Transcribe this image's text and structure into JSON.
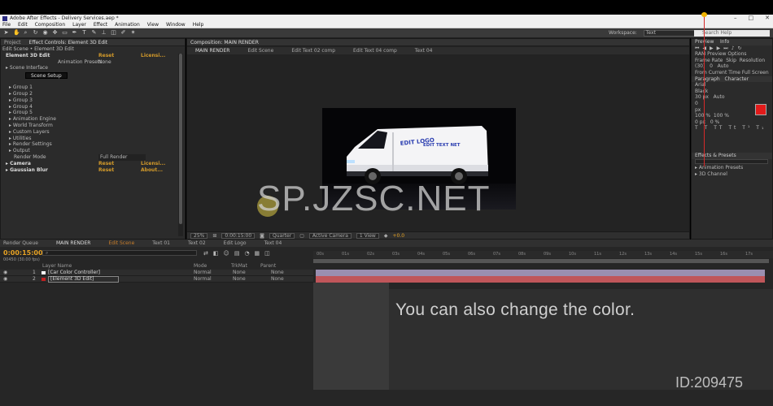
{
  "window": {
    "title": "Adobe After Effects - Delivery Services.aep *",
    "controls": [
      "–",
      "□",
      "✕"
    ]
  },
  "menu": [
    "File",
    "Edit",
    "Composition",
    "Layer",
    "Effect",
    "Animation",
    "View",
    "Window",
    "Help"
  ],
  "toolbar": {
    "workspace_label": "Workspace:",
    "workspace_value": "Text",
    "search_placeholder": "Search Help"
  },
  "effect_controls": {
    "tabs": [
      "Project",
      "Effect Controls: Element 3D Edit"
    ],
    "breadcrumb": "Edit Scene • Element 3D Edit",
    "rows": [
      {
        "label": "Element 3D Edit",
        "v": "Reset",
        "v2": "Licensi...",
        "bold": true
      },
      {
        "label": "Animation Presets:",
        "v": "None",
        "v2": "",
        "bold": false
      },
      {
        "label": "▸ Scene Interface",
        "v": "",
        "v2": "",
        "bold": false
      }
    ],
    "scene_button": "Scene Setup",
    "groups": [
      "▸ Group 1",
      "▸ Group 2",
      "▸ Group 3",
      "▸ Group 4",
      "▸ Group 5",
      "▸ Animation Engine",
      "▸ World Transform",
      "▸ Custom Layers",
      "▸ Utilities",
      "▸ Render Settings",
      "▸ Output"
    ],
    "render_mode_label": "Render Mode",
    "render_mode_value": "Full Render",
    "footer_rows": [
      {
        "label": "▸ Camera",
        "v": "Reset",
        "v2": "Licensi..."
      },
      {
        "label": "▸ Gaussian Blur",
        "v": "Reset",
        "v2": "About..."
      }
    ]
  },
  "composition": {
    "title": "Composition: MAIN RENDER",
    "subtabs": [
      "MAIN RENDER",
      "Edit Scene",
      "Edit Text 02 comp",
      "Edit Text 04 comp",
      "Text 04"
    ],
    "van_text_1": "EDIT LOGO",
    "van_text_2": "EDIT TEXT NET",
    "zoom": "25%",
    "timecode": "0:00:15:00",
    "resolution": "Quarter",
    "camera": "Active Camera",
    "views": "1 View",
    "exposure": "+0.0"
  },
  "right_panel": {
    "preview_tabs": [
      "Preview",
      "Info"
    ],
    "ram_label": "RAM Preview Options",
    "frame_rate_label": "Frame Rate",
    "skip_label": "Skip",
    "resolution_label": "Resolution",
    "frame_rate_value": "(30)",
    "skip_value": "0",
    "resolution_value": "Auto",
    "from_current": "From Current Time",
    "full_screen": "Full Screen",
    "para_tabs": [
      "Paragraph",
      "Character"
    ],
    "font": "Arial",
    "style": "Black",
    "size": "30 px",
    "leading": "Auto",
    "tracking": "0",
    "stroke": "px",
    "scale_v": "100 %",
    "scale_h": "100 %",
    "baseline": "0 px",
    "tsume": "0 %",
    "text_color": "#e21a1a",
    "style_buttons": [
      "T",
      "T",
      "TT",
      "Tt",
      "T¹",
      "T₁"
    ],
    "effects_title": "Effects & Presets",
    "effects_items": [
      "▸ Animation Presets",
      "▸ 3D Channel"
    ]
  },
  "timeline": {
    "tabs": [
      "Render Queue",
      "MAIN RENDER",
      "Edit Scene",
      "Text 01",
      "Text 02",
      "Edit Logo",
      "Text 04"
    ],
    "timecode": "0:00:15:00",
    "fps": "00450 (30.00 fps)",
    "column_headers": [
      "Layer Name",
      "Mode",
      "TrkMat",
      "Parent"
    ],
    "layers": [
      {
        "num": "1",
        "name": "[Car Color Controller]",
        "mode": "Normal",
        "trkmat": "None",
        "parent": "None",
        "swatch": "#ffffff"
      },
      {
        "num": "2",
        "name": "[Element 3D Edit]",
        "mode": "Normal",
        "trkmat": "None",
        "parent": "None",
        "swatch": "#c02020"
      }
    ],
    "ruler_ticks": [
      "00s",
      "01s",
      "02s",
      "03s",
      "04s",
      "05s",
      "06s",
      "07s",
      "08s",
      "09s",
      "10s",
      "11s",
      "12s",
      "13s",
      "14s",
      "15s",
      "16s",
      "17s"
    ]
  },
  "caption": "You can also change the color.",
  "watermark": "SP.JZSC.NET",
  "id_tag": "ID:209475"
}
